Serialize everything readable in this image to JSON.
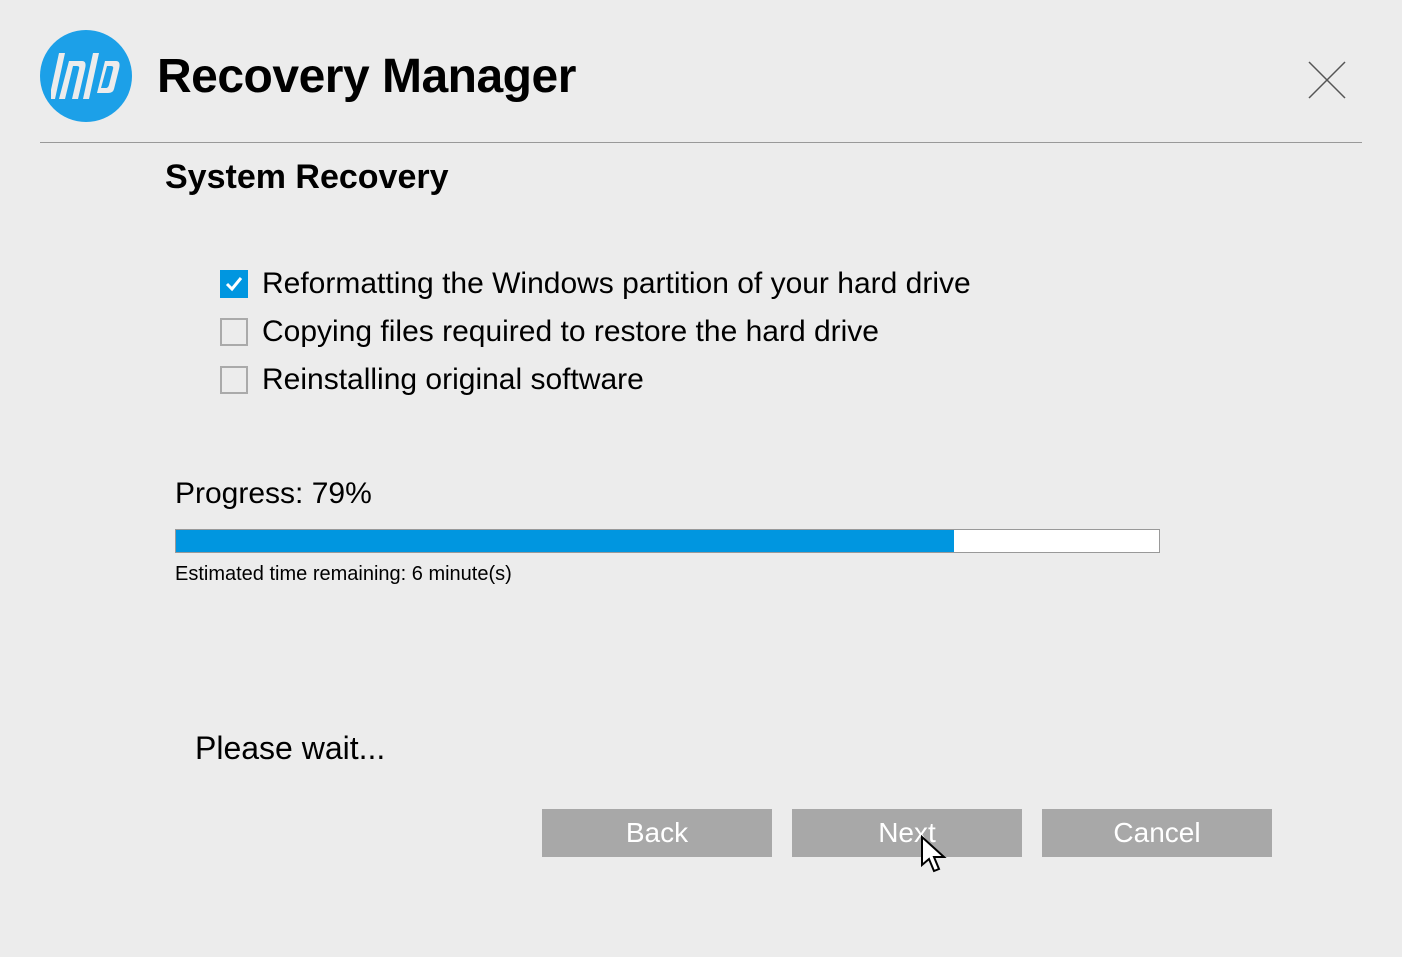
{
  "header": {
    "title": "Recovery Manager"
  },
  "section": {
    "title": "System Recovery"
  },
  "steps": [
    {
      "checked": true,
      "label": "Reformatting the Windows partition of your hard drive"
    },
    {
      "checked": false,
      "label": "Copying files required to restore the hard drive"
    },
    {
      "checked": false,
      "label": "Reinstalling original software"
    }
  ],
  "progress": {
    "label": "Progress: 79%",
    "percent": 79,
    "eta": "Estimated time remaining:  6 minute(s)"
  },
  "wait_text": "Please wait...",
  "buttons": {
    "back": "Back",
    "next": "Next",
    "cancel": "Cancel"
  }
}
